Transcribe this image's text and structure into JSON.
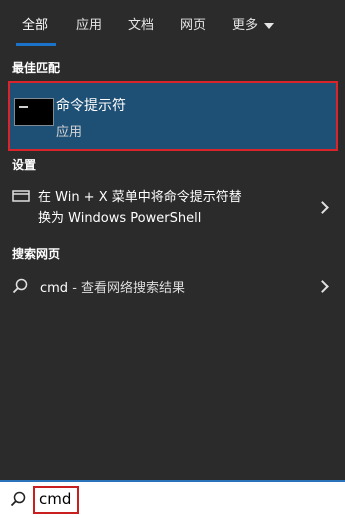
{
  "tabs": [
    {
      "label": "全部"
    },
    {
      "label": "应用"
    },
    {
      "label": "文档"
    },
    {
      "label": "网页"
    },
    {
      "label": "更多"
    }
  ],
  "best_match": {
    "heading": "最佳匹配",
    "title": "命令提示符",
    "subtitle": "应用",
    "icon": "cmd-window-icon"
  },
  "settings": {
    "heading": "设置",
    "item_line1": "在 Win + X 菜单中将命令提示符替",
    "item_line2": "换为 Windows PowerShell",
    "icon": "window-icon"
  },
  "web": {
    "heading": "搜索网页",
    "query": "cmd",
    "suffix": " - 查看网络搜索结果",
    "icon": "search-icon"
  },
  "search": {
    "value": "cmd",
    "icon": "search-icon"
  },
  "colors": {
    "accent": "#1a73c9",
    "highlight_border": "#d9252a",
    "selected_bg": "#1e4f74"
  }
}
